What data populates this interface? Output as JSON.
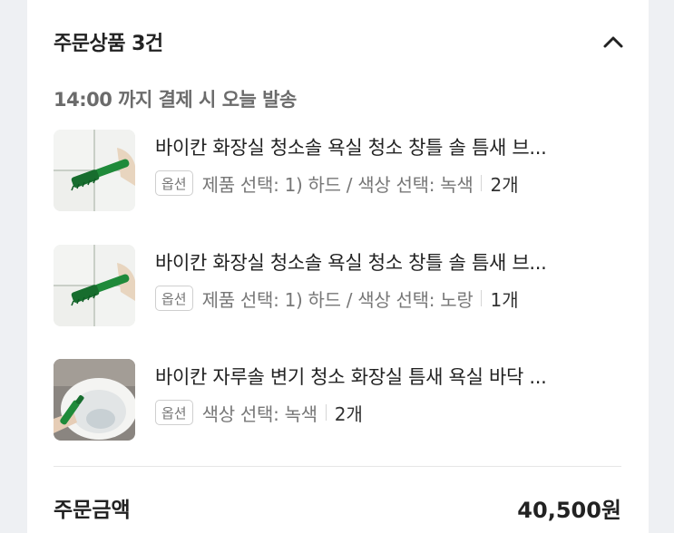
{
  "order": {
    "header_title": "주문상품 3건",
    "notice": "14:00 까지 결제 시 오늘 발송",
    "option_badge": "옵션",
    "items": [
      {
        "name": "바이칸 화장실 청소솔 욕실 청소 창틀 솔 틈새 브...",
        "option": "제품 선택: 1) 하드 / 색상 선택: 녹색",
        "quantity": "2개",
        "image_icon": "brush-tile-image"
      },
      {
        "name": "바이칸 화장실 청소솔 욕실 청소 창틀 솔 틈새 브...",
        "option": "제품 선택: 1) 하드 / 색상 선택: 노랑",
        "quantity": "1개",
        "image_icon": "brush-tile-image"
      },
      {
        "name": "바이칸 자루솔 변기 청소 화장실 틈새 욕실 바닥 ...",
        "option": "색상 선택: 녹색",
        "quantity": "2개",
        "image_icon": "toilet-brush-image"
      }
    ],
    "total_label": "주문금액",
    "total_value": "40,500원"
  },
  "colors": {
    "card_background": "#ffffff",
    "page_background": "#eef0f3",
    "primary_text": "#222222",
    "secondary_text": "#777777",
    "brush_green": "#1f8a3a"
  },
  "icons": {
    "collapse": "chevron-up-icon"
  }
}
